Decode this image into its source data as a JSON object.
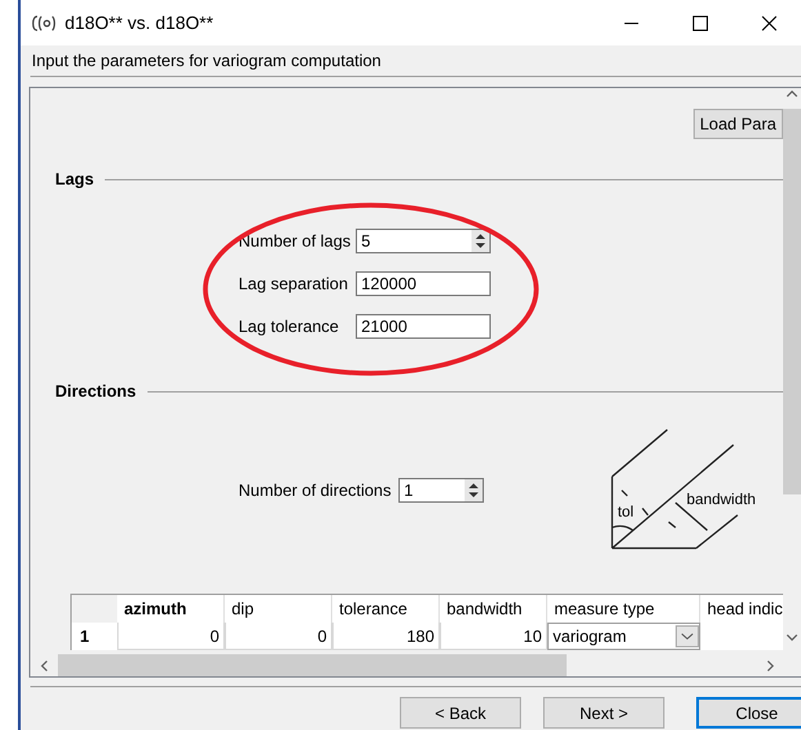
{
  "window": {
    "title": "d18O** vs. d18O**"
  },
  "instruction": "Input the parameters for variogram computation",
  "load_button": "Load Para",
  "lags": {
    "heading": "Lags",
    "fields": [
      {
        "label": "Number of lags",
        "value": "5",
        "kind": "spin"
      },
      {
        "label": "Lag separation",
        "value": "120000",
        "kind": "text"
      },
      {
        "label": "Lag tolerance",
        "value": "21000",
        "kind": "text"
      }
    ]
  },
  "directions": {
    "heading": "Directions",
    "field": {
      "label": "Number of directions",
      "value": "1",
      "kind": "spin"
    },
    "diagram_labels": [
      "tol",
      "bandwidth"
    ]
  },
  "table": {
    "columns": [
      {
        "label": "azimuth",
        "selected": true
      },
      {
        "label": "dip",
        "selected": false
      },
      {
        "label": "tolerance",
        "selected": false
      },
      {
        "label": "bandwidth",
        "selected": false
      },
      {
        "label": "measure type",
        "selected": false
      },
      {
        "label": "head indic",
        "selected": false
      }
    ],
    "rows": [
      {
        "header": "1",
        "cells": [
          {
            "value": "0",
            "kind": "number"
          },
          {
            "value": "0",
            "kind": "number"
          },
          {
            "value": "180",
            "kind": "number"
          },
          {
            "value": "10",
            "kind": "number"
          },
          {
            "value": "variogram",
            "kind": "dropdown"
          },
          {
            "kind": "empty"
          }
        ]
      }
    ]
  },
  "buttons": [
    {
      "label": "< Back",
      "default": false
    },
    {
      "label": "Next >",
      "default": false
    },
    {
      "label": "Close",
      "default": true
    }
  ],
  "annotation": {
    "kind": "ellipse",
    "color": "#e8202a"
  }
}
